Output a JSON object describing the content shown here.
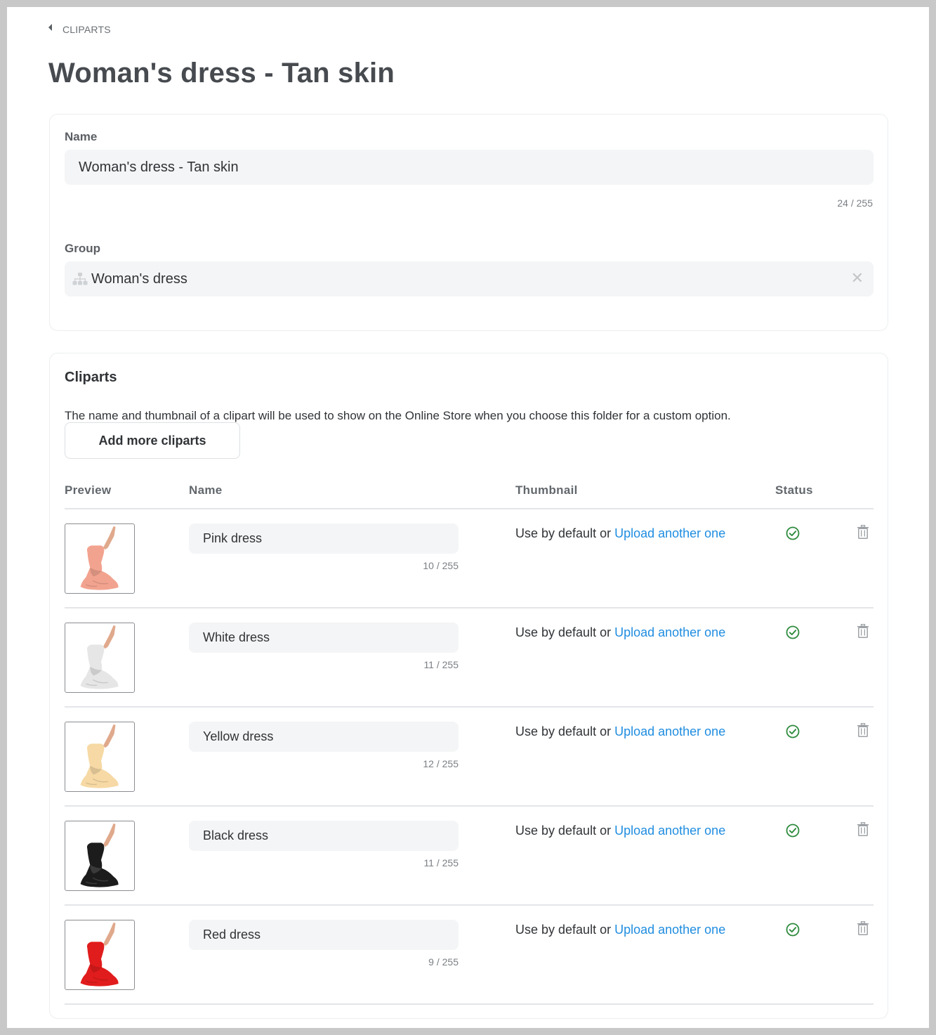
{
  "breadcrumb": {
    "label": "CLIPARTS"
  },
  "page": {
    "title": "Woman's dress - Tan skin"
  },
  "name_field": {
    "label": "Name",
    "value": "Woman's dress - Tan skin",
    "counter": "24 / 255"
  },
  "group_field": {
    "label": "Group",
    "value": "Woman's dress",
    "icon": "sitemap-icon",
    "clear_glyph": "✕"
  },
  "cliparts": {
    "title": "Cliparts",
    "description": "The name and thumbnail of a clipart will be used to show on the Online Store when you choose this folder for a custom option.",
    "add_button": "Add more cliparts",
    "columns": {
      "preview": "Preview",
      "name": "Name",
      "thumbnail": "Thumbnail",
      "status": "Status"
    },
    "thumbnail_prefix": "Use by default or ",
    "thumbnail_link": "Upload another one",
    "items": [
      {
        "name": "Pink dress",
        "counter": "10 / 255",
        "color": "#f2a38f",
        "status": "active"
      },
      {
        "name": "White dress",
        "counter": "11 / 255",
        "color": "#e6e6e6",
        "status": "active"
      },
      {
        "name": "Yellow dress",
        "counter": "12 / 255",
        "color": "#f6d9a4",
        "status": "active"
      },
      {
        "name": "Black dress",
        "counter": "11 / 255",
        "color": "#1c1c1c",
        "status": "active"
      },
      {
        "name": "Red dress",
        "counter": "9 / 255",
        "color": "#e11c1c",
        "status": "active"
      }
    ]
  },
  "colors": {
    "skin": "#e0a98c",
    "link": "#1f8de0",
    "status_ok": "#2e8b3d",
    "icon_gray": "#9ea2a6"
  }
}
